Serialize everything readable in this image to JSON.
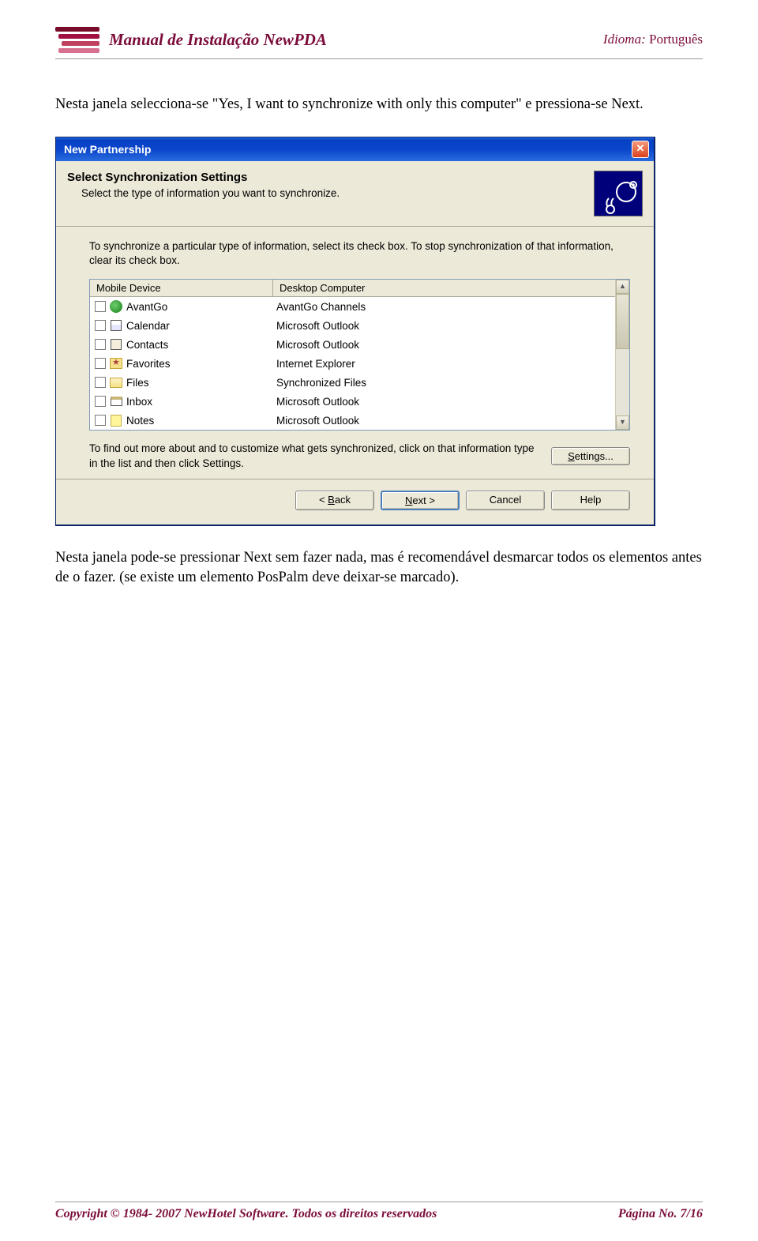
{
  "header": {
    "title": "Manual de Instalação NewPDA",
    "lang_label": "Idioma: ",
    "lang_value": "Português"
  },
  "para1": "Nesta janela selecciona-se \"Yes, I want to synchronize with only this computer\" e pressiona-se Next.",
  "dialog": {
    "title": "New Partnership",
    "heading": "Select Synchronization Settings",
    "subheading": "Select the type of information you want to synchronize.",
    "instr": "To synchronize a particular type of information, select its check box. To stop synchronization of that information, clear its check box.",
    "col1": "Mobile Device",
    "col2": "Desktop Computer",
    "rows": [
      {
        "m": "AvantGo",
        "d": "AvantGo Channels",
        "icon": "ic-avantgo"
      },
      {
        "m": "Calendar",
        "d": "Microsoft Outlook",
        "icon": "ic-cal"
      },
      {
        "m": "Contacts",
        "d": "Microsoft Outlook",
        "icon": "ic-contacts"
      },
      {
        "m": "Favorites",
        "d": "Internet Explorer",
        "icon": "ic-fav"
      },
      {
        "m": "Files",
        "d": "Synchronized Files",
        "icon": "ic-files open"
      },
      {
        "m": "Inbox",
        "d": "Microsoft Outlook",
        "icon": "ic-inbox"
      },
      {
        "m": "Notes",
        "d": "Microsoft Outlook",
        "icon": "ic-notes"
      }
    ],
    "settings_text": "To find out more about and to customize what gets synchronized, click on that information type in the list and then click Settings.",
    "settings_btn_pre": "S",
    "settings_btn_post": "ettings...",
    "back_lt": "< ",
    "back_u": "B",
    "back_post": "ack",
    "next_u": "N",
    "next_post": "ext >",
    "cancel": "Cancel",
    "help": "Help"
  },
  "para2": "Nesta janela pode-se pressionar Next sem fazer nada, mas é recomendável desmarcar todos os elementos antes de o fazer. (se existe um elemento PosPalm deve deixar-se marcado).",
  "footer": {
    "copyright": "Copyright © 1984- 2007 NewHotel Software. Todos os direitos reservados",
    "page": "Página No. 7/16"
  }
}
